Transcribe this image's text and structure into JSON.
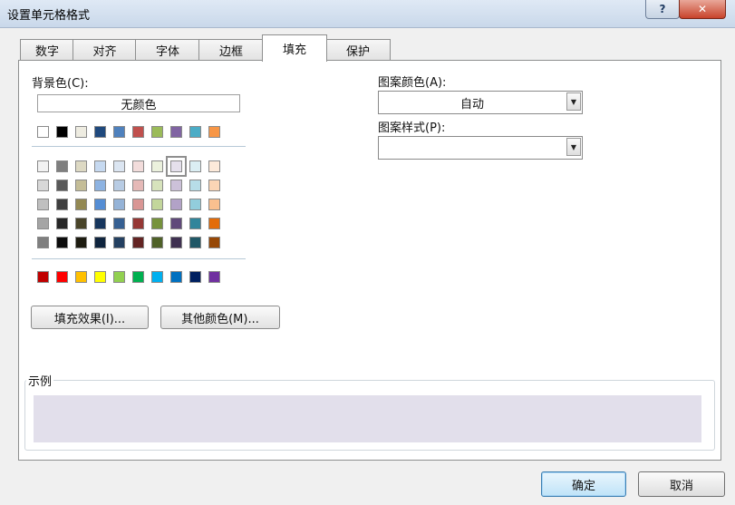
{
  "window": {
    "title": "设置单元格格式",
    "help_label": "?",
    "close_label": "✕"
  },
  "tabs": [
    {
      "label": "数字"
    },
    {
      "label": "对齐"
    },
    {
      "label": "字体"
    },
    {
      "label": "边框"
    },
    {
      "label": "填充",
      "active": true
    },
    {
      "label": "保护"
    }
  ],
  "fill": {
    "background_label": "背景色(C):",
    "no_color_label": "无颜色",
    "palette_top": [
      "#ffffff",
      "#000000",
      "#eeece1",
      "#1f497d",
      "#4f81bd",
      "#c0504d",
      "#9bbb59",
      "#8064a2",
      "#4bacc6",
      "#f79646"
    ],
    "palette_shades": [
      [
        "#f2f2f2",
        "#7f7f7f",
        "#ddd9c3",
        "#c6d9f0",
        "#dbe5f1",
        "#f2dcdb",
        "#ebf1dd",
        "#e5e0ec",
        "#dbeef3",
        "#fdeada"
      ],
      [
        "#d8d8d8",
        "#595959",
        "#c4bd97",
        "#8db3e2",
        "#b8cce4",
        "#e5b9b7",
        "#d7e3bc",
        "#ccc1d9",
        "#b7dde8",
        "#fbd5b5"
      ],
      [
        "#bfbfbf",
        "#3f3f3f",
        "#938953",
        "#548dd4",
        "#95b3d7",
        "#d99694",
        "#c3d69b",
        "#b2a2c7",
        "#92cddc",
        "#fac08f"
      ],
      [
        "#a5a5a5",
        "#262626",
        "#494429",
        "#17365d",
        "#366092",
        "#953734",
        "#76923c",
        "#5f497a",
        "#31859b",
        "#e36c09"
      ],
      [
        "#7f7f7f",
        "#0c0c0c",
        "#1d1b10",
        "#0f243e",
        "#244061",
        "#632423",
        "#4f6128",
        "#3f3151",
        "#205867",
        "#974806"
      ]
    ],
    "palette_standard": [
      "#c00000",
      "#ff0000",
      "#ffc000",
      "#ffff00",
      "#92d050",
      "#00b050",
      "#00b0f0",
      "#0070c0",
      "#002060",
      "#7030a0"
    ],
    "fill_effects_label": "填充效果(I)...",
    "more_colors_label": "其他颜色(M)...",
    "pattern_color_label": "图案颜色(A):",
    "pattern_color_value": "自动",
    "pattern_style_label": "图案样式(P):",
    "pattern_style_value": "",
    "sample_label": "示例",
    "sample_color": "#e2dfeb"
  },
  "buttons": {
    "ok_label": "确定",
    "cancel_label": "取消"
  }
}
